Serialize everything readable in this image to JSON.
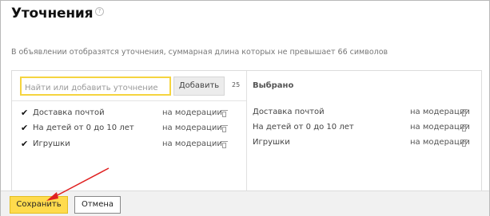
{
  "dialog": {
    "title": "Уточнения",
    "help_icon": "question-circle-icon",
    "hint": "В объявлении отобразятся уточнения, суммарная длина которых не превышает 66 символов"
  },
  "search": {
    "placeholder": "Найти или добавить уточнение",
    "value": "",
    "add_label": "Добавить",
    "count": "25"
  },
  "available": {
    "items": [
      {
        "label": "Доставка почтой",
        "status": "на модерации",
        "checked": true
      },
      {
        "label": "На детей от 0 до 10 лет",
        "status": "на модерации",
        "checked": true
      },
      {
        "label": "Игрушки",
        "status": "на модерации",
        "checked": true
      }
    ]
  },
  "selected": {
    "title": "Выбрано",
    "items": [
      {
        "label": "Доставка почтой",
        "status": "на модерации"
      },
      {
        "label": "На детей от 0 до 10 лет",
        "status": "на модерации"
      },
      {
        "label": "Игрушки",
        "status": "на модерации"
      }
    ]
  },
  "footer": {
    "save_label": "Сохранить",
    "cancel_label": "Отмена"
  },
  "colors": {
    "save_button": "#ffdb4d",
    "search_focus_border": "#f5d43f",
    "annotation_arrow": "#e02020"
  },
  "icons": {
    "check": "✔",
    "trash": "trash-icon",
    "annotation": "red-arrow-icon"
  }
}
